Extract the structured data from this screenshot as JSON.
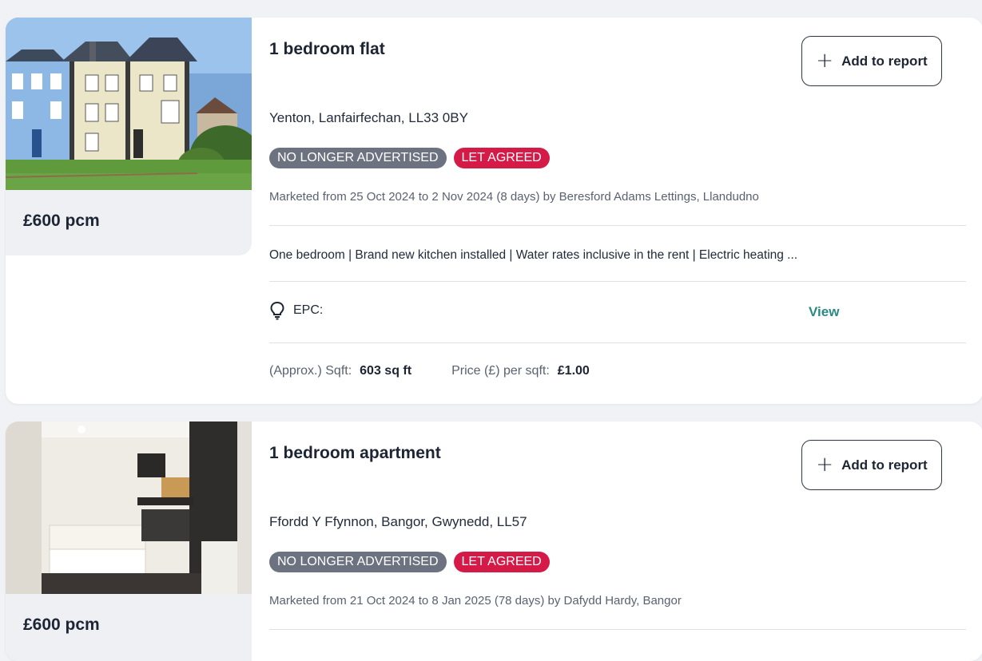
{
  "listings": [
    {
      "title": "1 bedroom flat",
      "price": "£600 pcm",
      "add_button_label": "Add to report",
      "address": "Yenton, Lanfairfechan, LL33 0BY",
      "badges": [
        "NO LONGER ADVERTISED",
        "LET AGREED"
      ],
      "marketed": "Marketed from 25 Oct 2024 to 2 Nov 2024 (8 days) by Beresford Adams Lettings, Llandudno",
      "summary": "One bedroom | Brand new kitchen installed | Water rates inclusive in the rent | Electric heating ...",
      "epc_label": "EPC:",
      "epc_link": "View",
      "sqft_label": "(Approx.) Sqft:",
      "sqft_value": "603 sq ft",
      "price_per_sqft_label": "Price (£) per sqft:",
      "price_per_sqft_value": "£1.00",
      "photo_icon": "house-photo"
    },
    {
      "title": "1 bedroom apartment",
      "price": "£600 pcm",
      "add_button_label": "Add to report",
      "address": "Ffordd Y Ffynnon, Bangor, Gwynedd, LL57",
      "badges": [
        "NO LONGER ADVERTISED",
        "LET AGREED"
      ],
      "marketed": "Marketed from 21 Oct 2024 to 8 Jan 2025 (78 days) by Dafydd Hardy, Bangor",
      "photo_icon": "bedroom-photo"
    }
  ],
  "colors": {
    "badge_grey": "#6d7280",
    "badge_red": "#d51a47",
    "link_teal": "#2a8a83",
    "page_background": "#f1f2f5"
  },
  "icons": {
    "add": "plus-icon",
    "epc": "lightbulb-icon"
  }
}
